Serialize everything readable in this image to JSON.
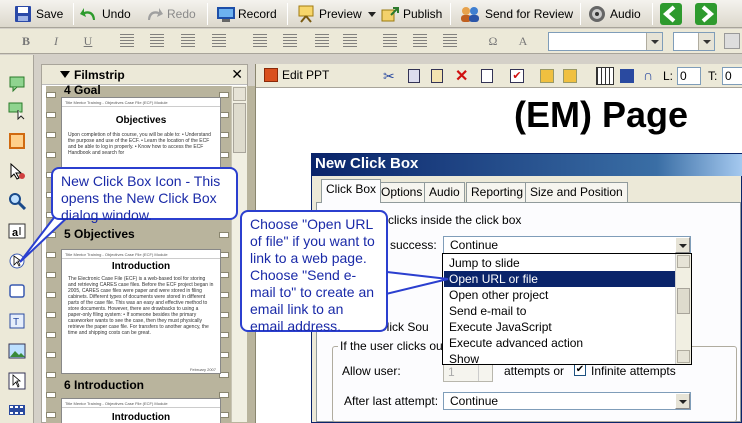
{
  "toolbar": {
    "save": "Save",
    "undo": "Undo",
    "redo": "Redo",
    "record": "Record",
    "preview": "Preview",
    "publish": "Publish",
    "send_for_review": "Send for Review",
    "audio": "Audio"
  },
  "format_bar": {
    "bold": "B",
    "italic": "I",
    "underline": "U",
    "omega": "Ω",
    "zoom_value": "",
    "left_label": "L:",
    "left_value": "0",
    "top_label": "T:",
    "top_value": "0"
  },
  "filmstrip": {
    "title": "Filmstrip",
    "slides": [
      {
        "label": "4 Goal",
        "title": "Objectives",
        "header_text": "Title Mentor Training - Objectives Case File (ECF) Module"
      },
      {
        "label": "5 Objectives",
        "title": "Introduction",
        "header_text": "Title Mentor Training - Objectives Case File (ECF) Module"
      },
      {
        "label": "6 Introduction",
        "title": "Introduction",
        "header_text": "Title Mentor Training - Objectives Case File (ECF) Module"
      }
    ],
    "slide1_text": "Upon completion of this course, you will be able to: • Understand the purpose and use of the ECF. • Learn the location of the ECF and be able to log in properly. • Know how to access the ECF Handbook and search for",
    "slide2_text": "The Electronic Case File (ECF) is a web-based tool for storing and retrieving CARES case files. Before the ECF project began in 2005, CARES case files were paper and were stored in filing cabinets. Different types of documents were stored in different parts of the case file. This was an easy and effective method to store documents. However, there are drawbacks to using a paper-only filing system: • If someone besides the primary caseworker wants to see the case, then they must physically retrieve the paper case file. For transfers to another agency, the time and shipping costs can be great.",
    "slide2_footer": "February 2007"
  },
  "edit": {
    "tab_label": "Edit PPT",
    "page_heading": "(EM) Page"
  },
  "dialog": {
    "title": "New Click Box",
    "tabs": [
      "Click Box",
      "Options",
      "Audio",
      "Reporting",
      "Size and Position"
    ],
    "row1_text": "clicks inside the click box",
    "on_success_label": "success:",
    "on_success_value": "Continue",
    "click_sound_label": "e Click Sou",
    "fieldset_label": "If the user clicks outsi",
    "allow_user_label": "Allow user:",
    "attempts_value": "1",
    "attempts_or": "attempts or",
    "infinite_attempts": "Infinite attempts",
    "after_last_label": "After last attempt:",
    "after_last_value": "Continue"
  },
  "dropdown_options": [
    "Jump to slide",
    "Open URL or file",
    "Open other project",
    "Send e-mail to",
    "Execute JavaScript",
    "Execute advanced action",
    "Show"
  ],
  "dropdown_selected": "Open URL or file",
  "callouts": {
    "c1": "New Click Box Icon - This opens the New Click Box dialog window.",
    "c2": "Choose \"Open URL of file\" if you want to link to a web page. Choose \"Send e-mail to\" to create an email link to an email address."
  }
}
